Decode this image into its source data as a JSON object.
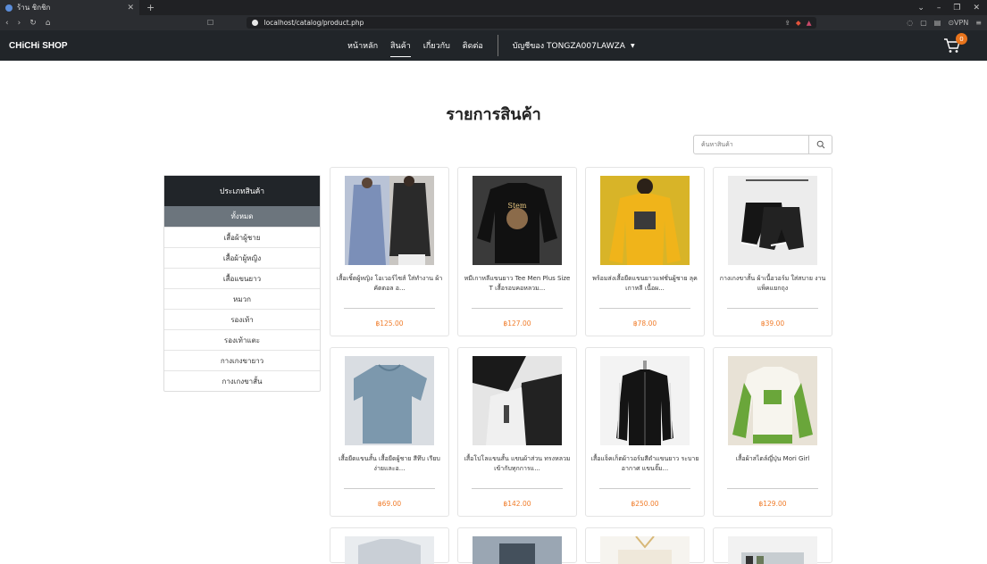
{
  "browser": {
    "tab_title": "ร้าน ชิกชิก",
    "url": "localhost/catalog/product.php"
  },
  "navbar": {
    "brand": "CHiCHi SHOP",
    "menu": [
      "หน้าหลัก",
      "สินค้า",
      "เกี่ยวกับ",
      "ติดต่อ"
    ],
    "account": "บัญชีของ TONGZA007LAWZA",
    "cart_count": "0"
  },
  "page": {
    "title": "รายการสินค้า",
    "search_placeholder": "ค้นหาสินค้า"
  },
  "sidebar": {
    "header": "ประเภทสินค้า",
    "items": [
      "ทั้งหมด",
      "เสื้อผ้าผู้ชาย",
      "เสื้อผ้าผู้หญิง",
      "เสื้อแขนยาว",
      "หมวก",
      "รองเท้า",
      "รองเท้าแตะ",
      "กางเกงขายาว",
      "กางเกงขาสั้น"
    ],
    "active_index": 0
  },
  "products": [
    {
      "name": "เสื้อเชิ้ตผู้หญิง โอเวอร์ไซส์ ใส่ทำงาน ผ้าคัตตอล อ...",
      "price": "฿125.00"
    },
    {
      "name": "หมีเกาหลีแขนยาว Tee Men Plus Size T เสื้อรอบคอหลวม...",
      "price": "฿127.00"
    },
    {
      "name": "พร้อมส่งเสื้อยืดแขนยาวแฟชั่นผู้ชาย ลุคเกาหลี เนื้อผ...",
      "price": "฿78.00"
    },
    {
      "name": "กางเกงขาสั้น ผ้าเนื้อวอร์ม ใส่สบาย งานแพ็คแยกถุง",
      "price": "฿39.00"
    },
    {
      "name": "เสื้อยืดแขนสั้น เสื้อยืดผู้ชาย สีทึบ เรียบง่ายและอ...",
      "price": "฿69.00"
    },
    {
      "name": "เสื้อโปโลแขนสั้น แขนผ้าส่วน ทรงหลวม เข้ากับทุกการแ...",
      "price": "฿142.00"
    },
    {
      "name": "เสื้อแจ็คเก็ตผ้าวอร์มสีดำแขนยาว ระบายอากาศ แขนจั๊ม...",
      "price": "฿250.00"
    },
    {
      "name": "เสื้อผ้าสไตล์ญี่ปุ่น Mori Girl",
      "price": "฿129.00"
    }
  ],
  "colors": {
    "navbar": "#212529",
    "price": "#f07c2a",
    "active_category": "#6c757d",
    "cart_badge": "#e8741c"
  }
}
